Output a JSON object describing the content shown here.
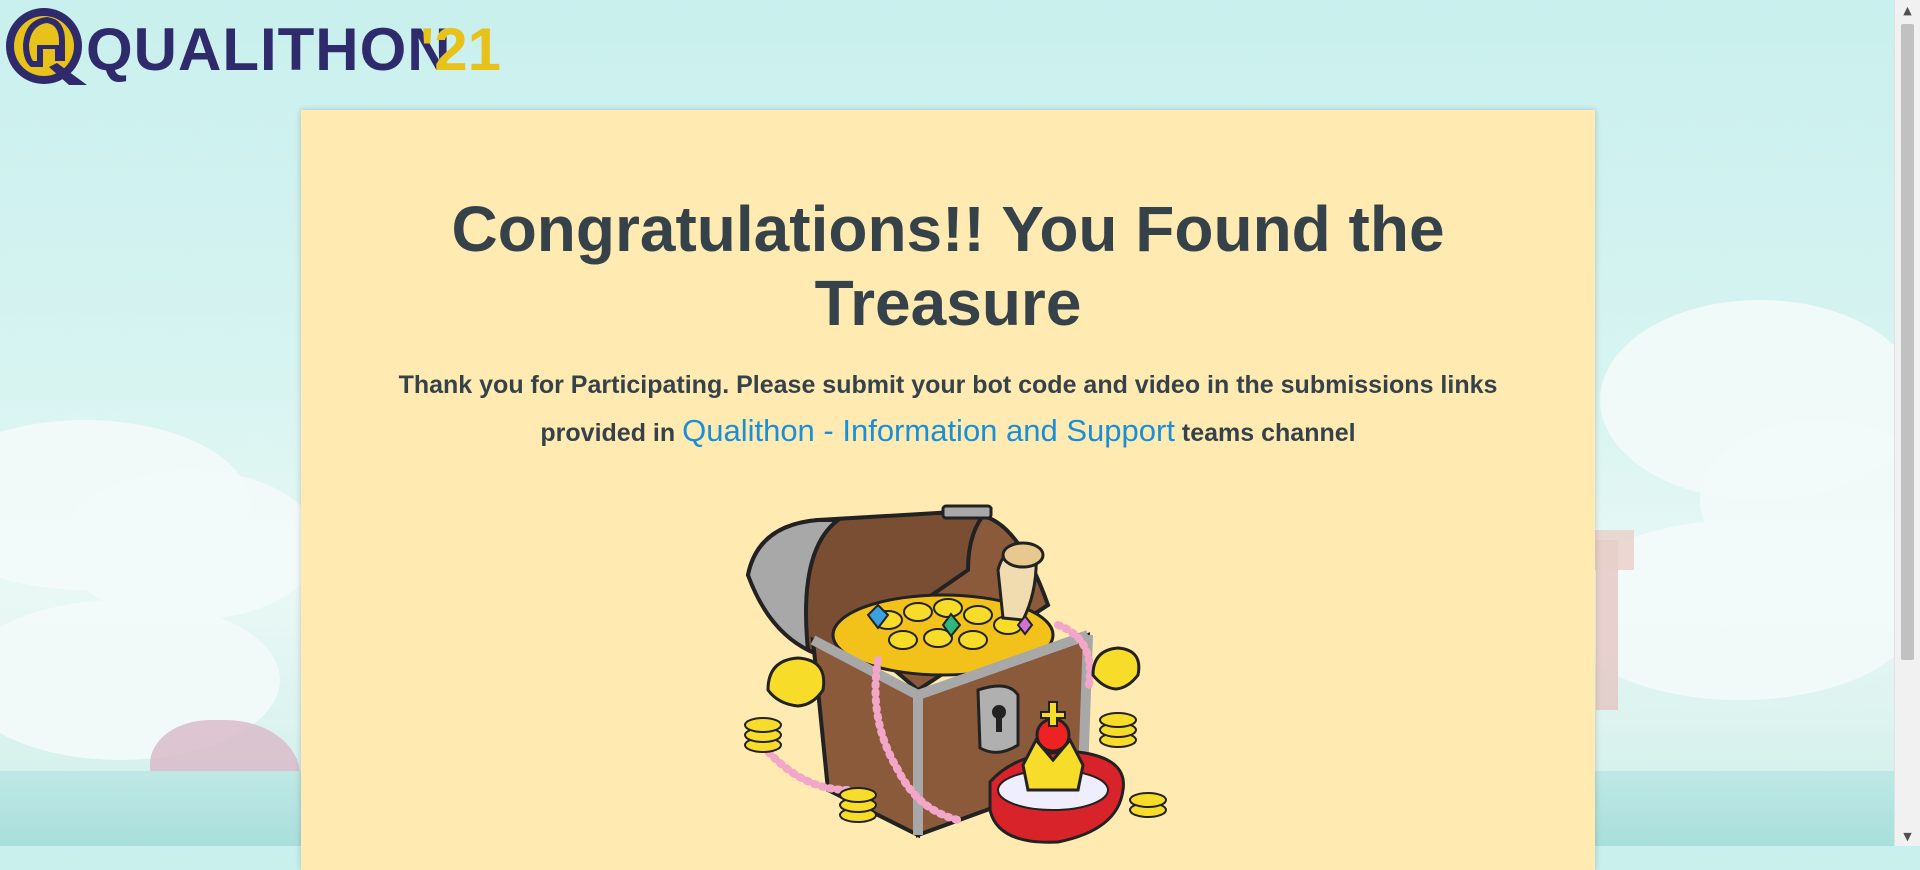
{
  "logo": {
    "name": "QUALITHON",
    "year": "'21"
  },
  "card": {
    "title": "Congratulations!! You Found the Treasure",
    "message_pre": "Thank you for Participating. Please submit your bot code and video in the submissions links provided in",
    "link_text": "Qualithon - Information and Support",
    "message_post": "teams channel"
  },
  "colors": {
    "title_text": "#36424a",
    "link": "#1a8fd8",
    "card_bg": "#ffeab1",
    "logo_navy": "#2e2a6b",
    "logo_gold": "#e7c21a"
  },
  "icons": {
    "logo_mark": "spartan-helmet-icon",
    "image": "treasure-chest"
  }
}
